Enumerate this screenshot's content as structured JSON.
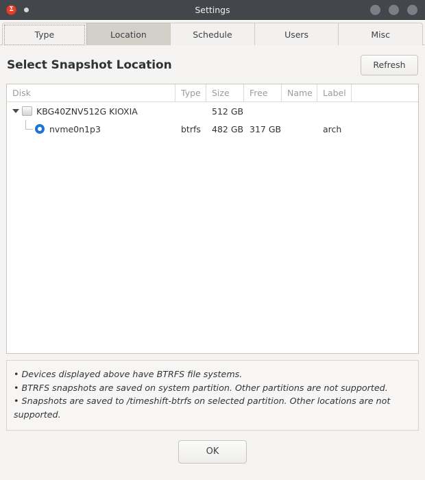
{
  "window": {
    "title": "Settings",
    "app_icon": "timeshift-icon",
    "titlebar_color": "#43464b",
    "controls": [
      "minimize-button",
      "maximize-button",
      "close-button"
    ]
  },
  "tabs": [
    {
      "label": "Type",
      "name": "tab-type",
      "active": false,
      "focused": true
    },
    {
      "label": "Location",
      "name": "tab-location",
      "active": true,
      "focused": false
    },
    {
      "label": "Schedule",
      "name": "tab-schedule",
      "active": false,
      "focused": false
    },
    {
      "label": "Users",
      "name": "tab-users",
      "active": false,
      "focused": false
    },
    {
      "label": "Misc",
      "name": "tab-misc",
      "active": false,
      "focused": false
    }
  ],
  "main": {
    "page_title": "Select Snapshot Location",
    "refresh_label": "Refresh"
  },
  "table": {
    "columns": [
      "Disk",
      "Type",
      "Size",
      "Free",
      "Name",
      "Label"
    ],
    "rows": [
      {
        "disk": "KBG40ZNV512G KIOXIA",
        "type": "",
        "size": "512 GB",
        "free": "",
        "name": "",
        "label": "",
        "kind": "drive",
        "expanded": true,
        "selected": false
      },
      {
        "disk": "nvme0n1p3",
        "type": "btrfs",
        "size": "482 GB",
        "free": "317 GB",
        "name": "",
        "label": "arch",
        "kind": "partition",
        "expanded": false,
        "selected": true
      }
    ]
  },
  "info": {
    "line1": "• Devices displayed above have BTRFS file systems.",
    "line2": "• BTRFS snapshots are saved on system partition. Other partitions are not supported.",
    "line3": "• Snapshots are saved to /timeshift-btrfs on selected partition. Other locations are not supported."
  },
  "footer": {
    "ok_label": "OK"
  },
  "colors": {
    "accent": "#1e73d8",
    "titlebar": "#43464b",
    "active_tab": "#d3cfc9",
    "window_bg": "#f5f4f2"
  }
}
